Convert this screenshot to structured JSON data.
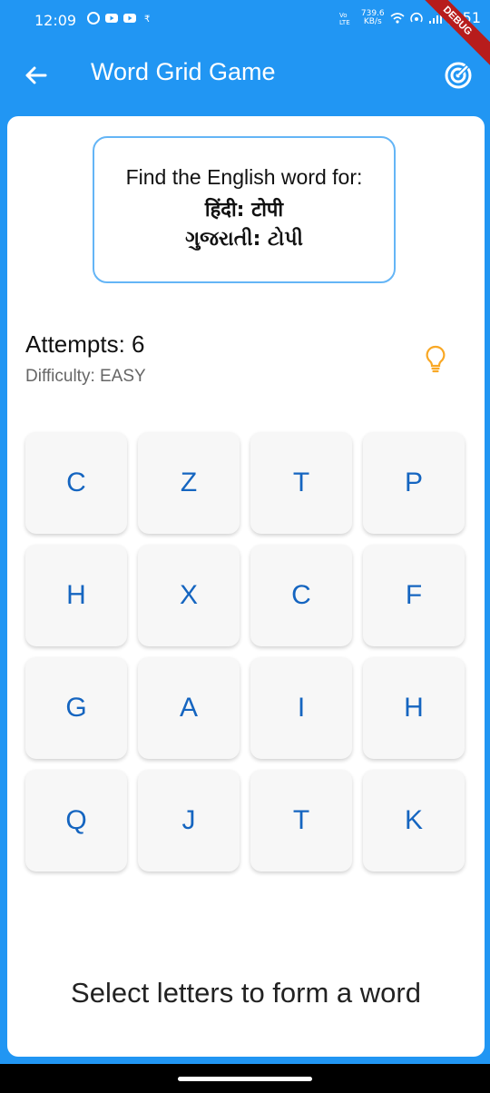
{
  "status_bar": {
    "time": "12:09",
    "net_speed_top": "739.6",
    "net_speed_bottom": "KB/s",
    "network_label": "Vo LTE",
    "battery": "51",
    "debug_label": "DEBUG"
  },
  "app_bar": {
    "title": "Word Grid Game",
    "back_icon": "back-arrow-icon",
    "action_icon": "target-icon",
    "color": "#2196F3"
  },
  "prompt": {
    "line1": "Find the English word for:",
    "line2": "हिंदी: टोपी",
    "line3": "ગુજરાતી: ટોપી",
    "border_color": "#64B5F6"
  },
  "stats": {
    "attempts": "Attempts: 6",
    "difficulty": "Difficulty: EASY",
    "hint_icon": "lightbulb-icon",
    "hint_color": "#F9A825"
  },
  "grid": {
    "letters": [
      "C",
      "Z",
      "T",
      "P",
      "H",
      "X",
      "C",
      "F",
      "G",
      "A",
      "I",
      "H",
      "Q",
      "J",
      "T",
      "K"
    ],
    "letter_color": "#1565C0"
  },
  "footer": {
    "message": "Select letters to form a word"
  }
}
